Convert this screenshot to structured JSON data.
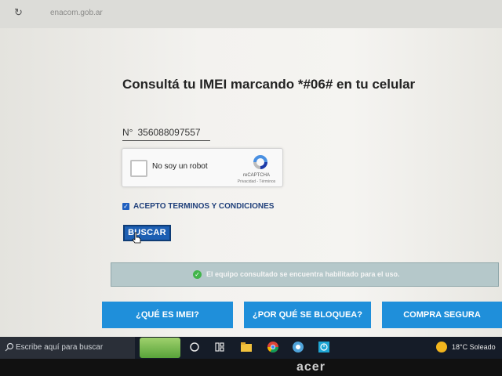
{
  "browser": {
    "url": "enacom.gob.ar"
  },
  "page": {
    "title": "Consultá tu IMEI marcando *#06# en tu celular",
    "imei_prefix": "N°",
    "imei_value": "356088097557",
    "captcha": {
      "label": "No soy un robot",
      "brand": "reCAPTCHA",
      "links": "Privacidad - Términos"
    },
    "terms_label": "ACEPTO TERMINOS Y CONDICIONES",
    "terms_checked": true,
    "search_button": "BUSCAR",
    "status_message": "El equipo consultado se encuentra habilitado para el uso.",
    "status_color": "#41b54a",
    "bottom_buttons": [
      "¿QUÉ ES IMEI?",
      "¿POR QUÉ SE BLOQUEA?",
      "COMPRA SEGURA"
    ],
    "accent_color": "#1f8fda"
  },
  "taskbar": {
    "search_placeholder": "Escribe aquí para buscar",
    "temperature": "18°C",
    "weather": "Soleado",
    "apps": [
      "search-icon",
      "task-view-icon",
      "widgets-icon",
      "file-explorer-icon",
      "chrome-icon",
      "app-icon",
      "clock-app-icon"
    ]
  },
  "monitor_brand": "acer"
}
